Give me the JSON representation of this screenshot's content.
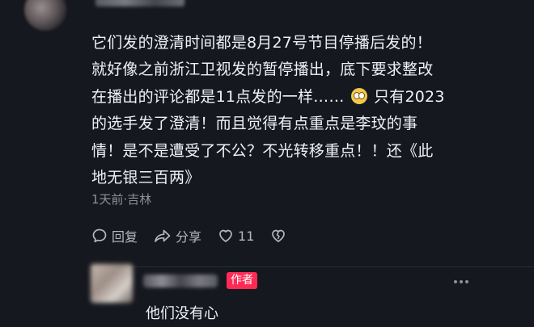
{
  "comment": {
    "lines": [
      "它们发的澄清时间都是8月27号节目停播后发的！",
      "就好像之前浙江卫视发的暂停播出，底下要求整改",
      "在播出的评论都是11点发的一样……",
      "只有2023",
      "的选手发了澄清！而且觉得有点重点是李玟的事",
      "情！是不是遭受了不公？不光转移重点！！还《此",
      "地无银三百两》"
    ],
    "emoji": "rolling-eyes-emoji",
    "meta": "1天前·吉林",
    "actions": {
      "reply_label": "回复",
      "share_label": "分享",
      "like_count": "11"
    }
  },
  "reply": {
    "author_badge": "作者",
    "text": "他们没有心"
  },
  "colors": {
    "background": "#16181f",
    "badge": "#fe2c55",
    "meta": "#8f9198"
  }
}
